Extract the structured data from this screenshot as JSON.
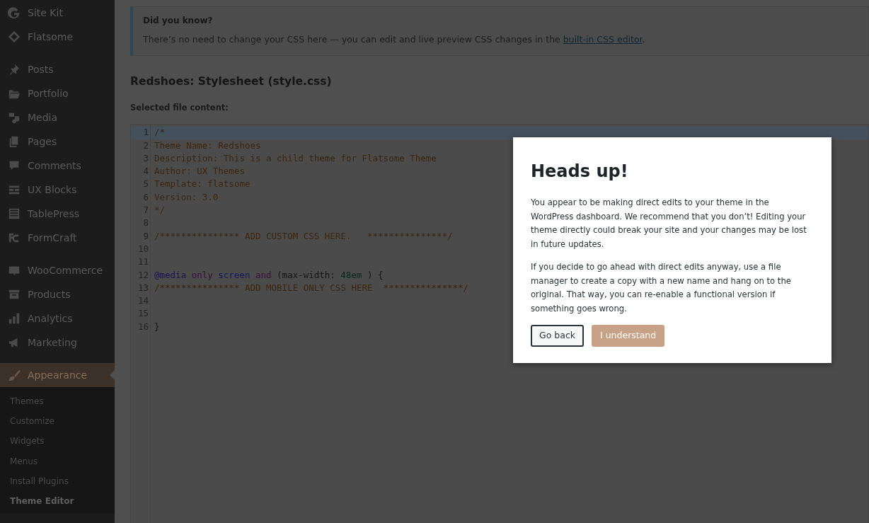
{
  "sidebar": {
    "groups": [
      {
        "items": [
          {
            "label": "Site Kit",
            "selected": false
          },
          {
            "label": "Flatsome",
            "selected": false
          }
        ]
      },
      {
        "items": [
          {
            "label": "Posts",
            "selected": false
          },
          {
            "label": "Portfolio",
            "selected": false
          },
          {
            "label": "Media",
            "selected": false
          },
          {
            "label": "Pages",
            "selected": false
          },
          {
            "label": "Comments",
            "selected": false
          },
          {
            "label": "UX Blocks",
            "selected": false
          },
          {
            "label": "TablePress",
            "selected": false
          },
          {
            "label": "FormCraft",
            "selected": false
          }
        ]
      },
      {
        "items": [
          {
            "label": "WooCommerce",
            "selected": false
          },
          {
            "label": "Products",
            "selected": false
          },
          {
            "label": "Analytics",
            "selected": false
          },
          {
            "label": "Marketing",
            "selected": false
          }
        ]
      },
      {
        "items": [
          {
            "label": "Appearance",
            "selected": true,
            "children": [
              {
                "label": "Themes",
                "selected": false
              },
              {
                "label": "Customize",
                "selected": false
              },
              {
                "label": "Widgets",
                "selected": false
              },
              {
                "label": "Menus",
                "selected": false
              },
              {
                "label": "Install Plugins",
                "selected": false
              },
              {
                "label": "Theme Editor",
                "selected": true
              }
            ]
          }
        ]
      }
    ]
  },
  "notice": {
    "title": "Did you know?",
    "text": "There’s no need to change your CSS here — you can edit and live preview CSS changes in the ",
    "link": "built-in CSS editor",
    "after": "."
  },
  "file_title": "Redshoes: Stylesheet (style.css)",
  "content_label": "Selected file content:",
  "editor": {
    "lines": [
      {
        "number": "1",
        "active": true,
        "tokens": [
          {
            "kind": "comment",
            "text": "/*"
          }
        ]
      },
      {
        "number": "2",
        "active": false,
        "tokens": [
          {
            "kind": "comment",
            "text": "Theme Name: Redshoes"
          }
        ]
      },
      {
        "number": "3",
        "active": false,
        "tokens": [
          {
            "kind": "comment",
            "text": "Description: This is a child theme for Flatsome Theme"
          }
        ]
      },
      {
        "number": "4",
        "active": false,
        "tokens": [
          {
            "kind": "comment",
            "text": "Author: UX Themes"
          }
        ]
      },
      {
        "number": "5",
        "active": false,
        "tokens": [
          {
            "kind": "comment",
            "text": "Template: flatsome"
          }
        ]
      },
      {
        "number": "6",
        "active": false,
        "tokens": [
          {
            "kind": "comment",
            "text": "Version: 3.0"
          }
        ]
      },
      {
        "number": "7",
        "active": false,
        "tokens": [
          {
            "kind": "comment",
            "text": "*/"
          }
        ]
      },
      {
        "number": "8",
        "active": false
      },
      {
        "number": "9",
        "active": false,
        "tokens": [
          {
            "kind": "comment",
            "text": "/*************** ADD CUSTOM CSS HERE.   ***************/"
          }
        ]
      },
      {
        "number": "10",
        "active": false
      },
      {
        "number": "11",
        "active": false
      },
      {
        "number": "12",
        "active": false,
        "tokens": [
          {
            "kind": "atrule",
            "text": "@media"
          },
          {
            "kind": "keyword",
            "text": "only"
          },
          {
            "kind": "attribute",
            "text": "screen"
          },
          {
            "kind": "keyword",
            "text": "and"
          },
          {
            "kind": "plain",
            "text": "(max-width:"
          },
          {
            "kind": "number",
            "text": "48em"
          },
          {
            "kind": "plain",
            "text": ") {"
          }
        ]
      },
      {
        "number": "13",
        "active": false,
        "tokens": [
          {
            "kind": "comment",
            "text": "/*************** ADD MOBILE ONLY CSS HERE  ***************/"
          }
        ]
      },
      {
        "number": "14",
        "active": false
      },
      {
        "number": "15",
        "active": false
      },
      {
        "number": "16",
        "active": false,
        "tokens": [
          {
            "kind": "plain",
            "text": "}"
          }
        ]
      }
    ]
  },
  "modal": {
    "title": "Heads up!",
    "paragraphs": [
      "You appear to be making direct edits to your theme in the WordPress dashboard. We recommend that you don’t! Editing your theme directly could break your site and your changes may be lost in future updates.",
      "If you decide to go ahead with direct edits anyway, use a file manager to create a copy with a new name and hang on to the original. That way, you can re-enable a functional version if something goes wrong."
    ],
    "buttons": [
      {
        "label": "Go back",
        "kind": "secondary"
      },
      {
        "label": "I understand",
        "kind": "primary"
      }
    ]
  }
}
